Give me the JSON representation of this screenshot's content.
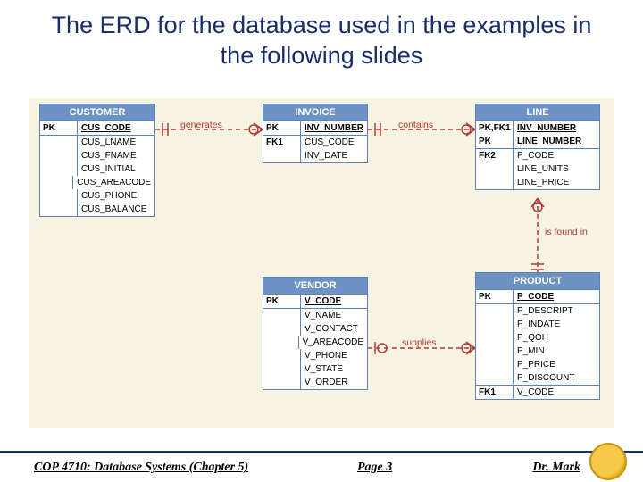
{
  "title": "The ERD for the database used in the examples in the following slides",
  "entities": {
    "customer": {
      "name": "CUSTOMER",
      "pk_keys": "PK",
      "pk_attr": "CUS_CODE",
      "attrs": [
        "CUS_LNAME",
        "CUS_FNAME",
        "CUS_INITIAL",
        "CUS_AREACODE",
        "CUS_PHONE",
        "CUS_BALANCE"
      ]
    },
    "invoice": {
      "name": "INVOICE",
      "pk_keys": "PK",
      "pk_attr": "INV_NUMBER",
      "rows": [
        {
          "k": "FK1",
          "a": "CUS_CODE"
        },
        {
          "k": "",
          "a": "INV_DATE"
        }
      ]
    },
    "line": {
      "name": "LINE",
      "pkrows": [
        {
          "k": "PK,FK1",
          "a": "INV_NUMBER"
        },
        {
          "k": "PK",
          "a": "LINE_NUMBER"
        }
      ],
      "rows": [
        {
          "k": "FK2",
          "a": "P_CODE"
        },
        {
          "k": "",
          "a": "LINE_UNITS"
        },
        {
          "k": "",
          "a": "LINE_PRICE"
        }
      ]
    },
    "vendor": {
      "name": "VENDOR",
      "pk_keys": "PK",
      "pk_attr": "V_CODE",
      "attrs": [
        "V_NAME",
        "V_CONTACT",
        "V_AREACODE",
        "V_PHONE",
        "V_STATE",
        "V_ORDER"
      ]
    },
    "product": {
      "name": "PRODUCT",
      "pk_keys": "PK",
      "pk_attr": "P_CODE",
      "attrs": [
        "P_DESCRIPT",
        "P_INDATE",
        "P_QOH",
        "P_MIN",
        "P_PRICE",
        "P_DISCOUNT"
      ],
      "fk": {
        "k": "FK1",
        "a": "V_CODE"
      }
    }
  },
  "relationships": {
    "generates": "generates",
    "contains": "contains",
    "is_found_in": "is found in",
    "supplies": "supplies"
  },
  "footer": {
    "left": "COP 4710: Database Systems  (Chapter 5)",
    "center": "Page 3",
    "right": "Dr. Mark"
  }
}
